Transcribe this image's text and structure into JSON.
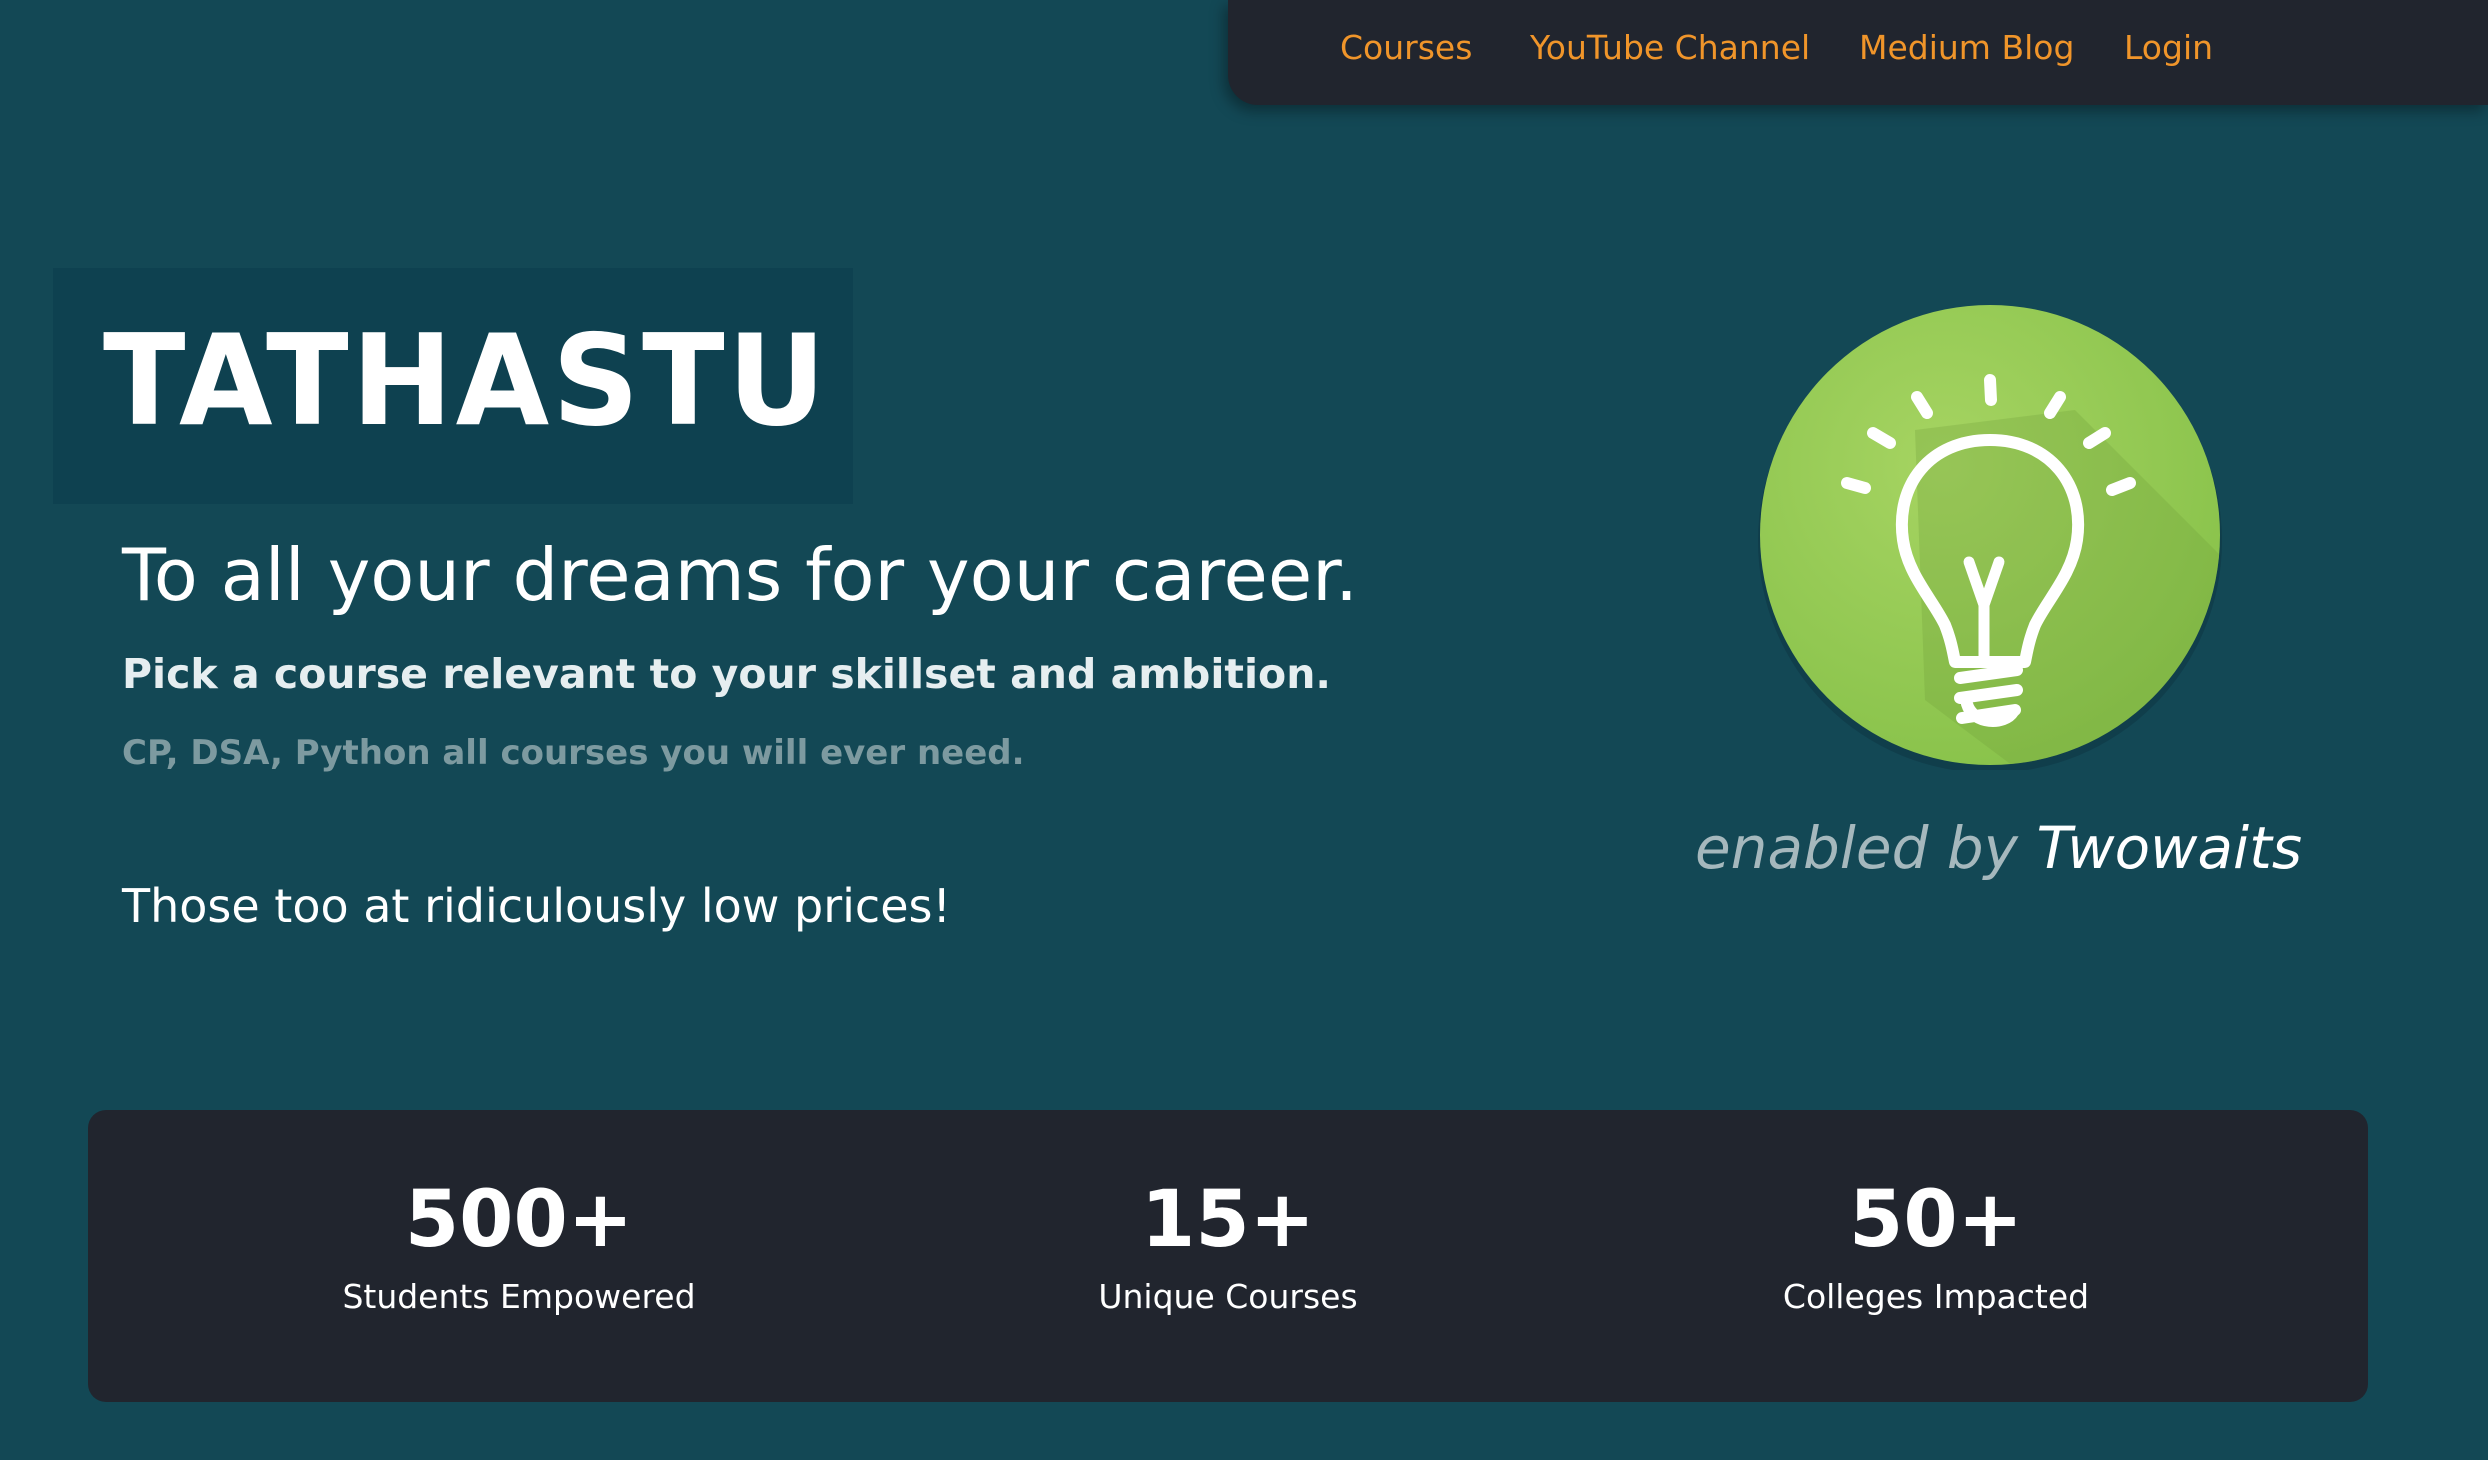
{
  "nav": {
    "items": [
      {
        "label": "Courses"
      },
      {
        "label": "YouTube Channel"
      },
      {
        "label": "Medium Blog"
      },
      {
        "label": "Login"
      }
    ]
  },
  "hero": {
    "brand": "TATHASTU",
    "headline": "To all your dreams for your career.",
    "subheadline": "Pick a course relevant to your skillset and ambition.",
    "courses_note": "CP, DSA, Python all courses you will ever need.",
    "tagline": "Those too at ridiculously low prices!"
  },
  "logo": {
    "icon": "lightbulb-icon",
    "enabled_prefix": "enabled by",
    "enabled_brand": "Twowaits"
  },
  "stats": [
    {
      "value": "500+",
      "label": "Students Empowered"
    },
    {
      "value": "15+",
      "label": "Unique Courses"
    },
    {
      "value": "50+",
      "label": "Colleges Impacted"
    }
  ],
  "colors": {
    "background": "#134855",
    "panel": "#21252e",
    "nav_link": "#f0952a",
    "logo_green": "#8fc84e"
  }
}
